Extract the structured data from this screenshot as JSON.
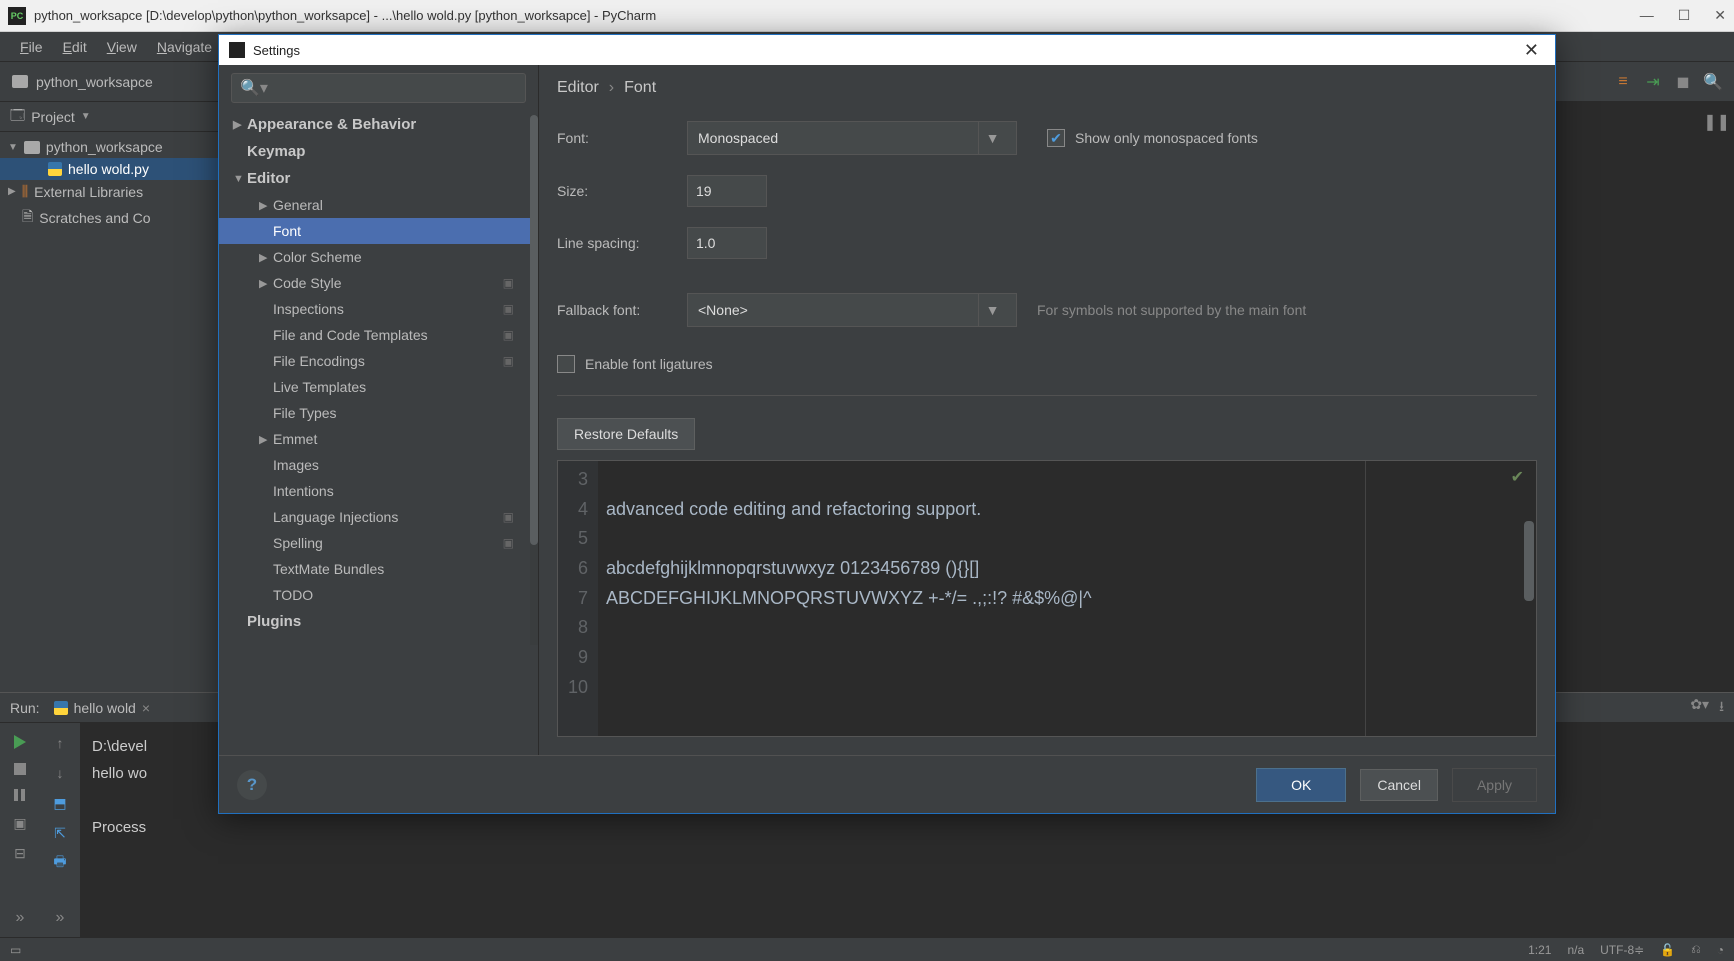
{
  "window": {
    "title": "python_worksapce [D:\\develop\\python\\python_worksapce] - ...\\hello wold.py [python_worksapce] - PyCharm"
  },
  "menu": {
    "file": "File",
    "edit": "Edit",
    "view": "View",
    "navigate": "Navigate"
  },
  "breadcrumb": {
    "root": "python_worksapce"
  },
  "project": {
    "label": "Project",
    "root": "python_worksapce",
    "file": "hello wold.py",
    "ext": "External Libraries",
    "scratch": "Scratches and Co"
  },
  "run": {
    "label": "Run:",
    "tab": "hello wold",
    "out1": "D:\\devel",
    "out2": "hello wo",
    "out3": "Process "
  },
  "status": {
    "pos": "1:21",
    "insert": "n/a",
    "enc": "UTF-8"
  },
  "dialog": {
    "title": "Settings",
    "crumb1": "Editor",
    "crumb2": "Font",
    "nav": {
      "appearance": "Appearance & Behavior",
      "keymap": "Keymap",
      "editor": "Editor",
      "general": "General",
      "font": "Font",
      "color_scheme": "Color Scheme",
      "code_style": "Code Style",
      "inspections": "Inspections",
      "file_code_templates": "File and Code Templates",
      "file_encodings": "File Encodings",
      "live_templates": "Live Templates",
      "file_types": "File Types",
      "emmet": "Emmet",
      "images": "Images",
      "intentions": "Intentions",
      "language_injections": "Language Injections",
      "spelling": "Spelling",
      "textmate": "TextMate Bundles",
      "todo": "TODO",
      "plugins": "Plugins"
    },
    "form": {
      "font_lbl": "Font:",
      "font_val": "Monospaced",
      "mono_only": "Show only monospaced fonts",
      "size_lbl": "Size:",
      "size_val": "19",
      "spacing_lbl": "Line spacing:",
      "spacing_val": "1.0",
      "fallback_lbl": "Fallback font:",
      "fallback_val": "<None>",
      "fallback_hint": "For symbols not supported by the main font",
      "ligatures": "Enable font ligatures",
      "restore": "Restore Defaults"
    },
    "preview": {
      "lines": [
        3,
        4,
        5,
        6,
        7,
        8,
        9,
        10
      ],
      "l3": "advanced code editing and refactoring support.",
      "l4": "",
      "l5": "abcdefghijklmnopqrstuvwxyz 0123456789 (){}[]",
      "l6": "ABCDEFGHIJKLMNOPQRSTUVWXYZ +-*/= .,;:!? #&$%@|^",
      "l7": "",
      "l8": "",
      "l9": "",
      "l10": ""
    },
    "buttons": {
      "ok": "OK",
      "cancel": "Cancel",
      "apply": "Apply"
    }
  }
}
